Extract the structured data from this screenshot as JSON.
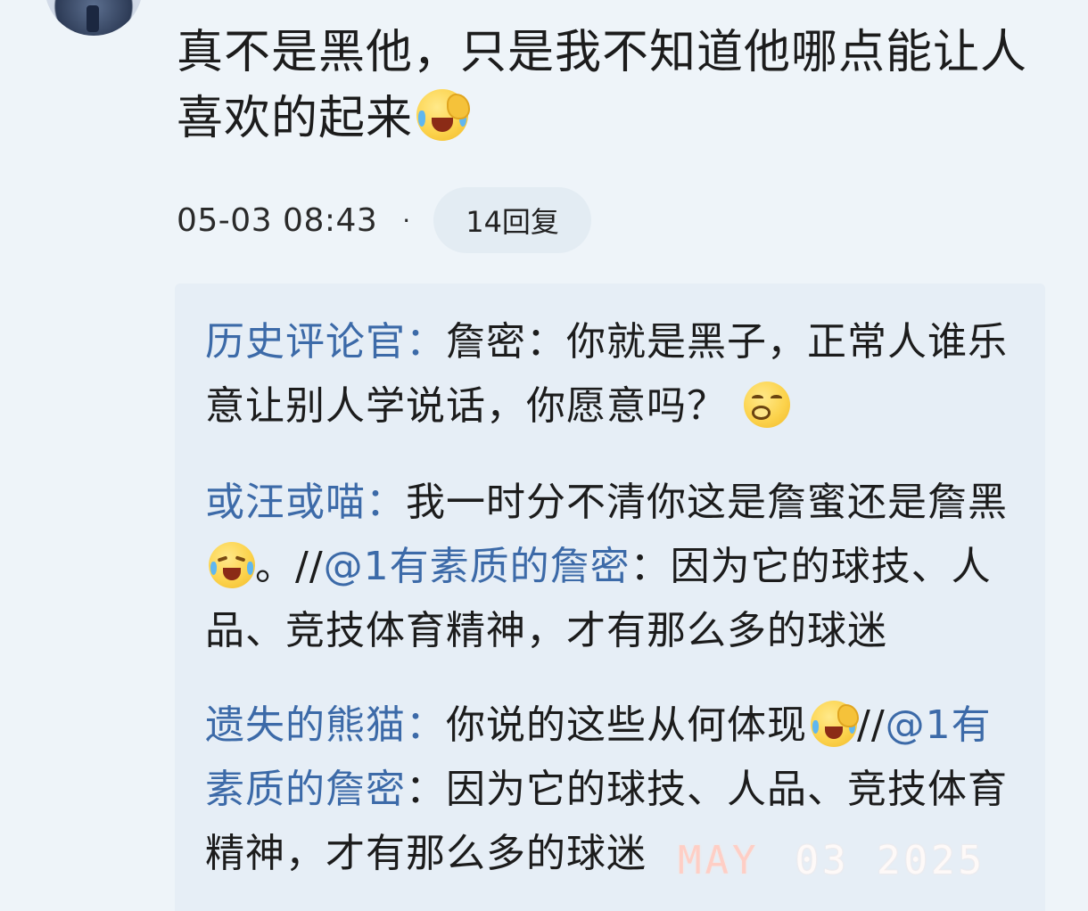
{
  "comment": {
    "text": "真不是黑他，只是我不知道他哪点能让人喜欢的起来",
    "emoji": "crying-face-emoji",
    "timestamp": "05-03 08:43",
    "separator": "·",
    "reply_count_label": "14回复"
  },
  "replies": [
    {
      "author": "历史评论官：",
      "text": "詹密：你就是黑子，正常人谁乐意让别人学说话，你愿意吗？",
      "emoji": "smirk-face-emoji"
    },
    {
      "author": "或汪或喵：",
      "text_before": "我一时分不清你这是詹蜜还是詹黑",
      "text_after": "。//",
      "mention": "@1有素质的詹密",
      "mention_suffix": "：因为它的球技、人品、竞技体育精神，才有那么多的球迷",
      "emoji": "laugh-cry-emoji"
    },
    {
      "author": "遗失的熊猫：",
      "text_before": "你说的这些从何体现",
      "text_after": "//",
      "mention": "@1有素质的詹密",
      "mention_suffix": "：因为它的球技、人品、竞技体育精神，才有那么多的球迷",
      "emoji": "crying-face-emoji"
    }
  ],
  "watermark": {
    "month": "MAY",
    "day": "03",
    "year": "2025"
  }
}
